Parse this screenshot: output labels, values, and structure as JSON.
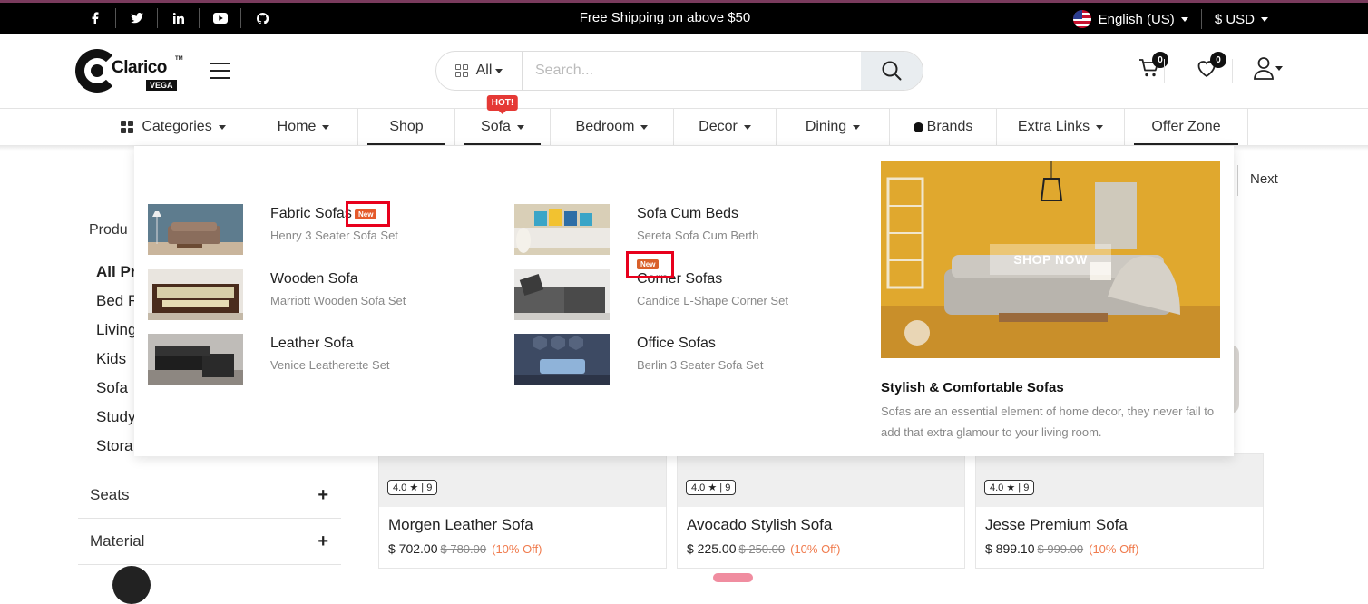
{
  "topbar": {
    "social": [
      {
        "name": "facebook-icon",
        "glyph": "f"
      },
      {
        "name": "twitter-icon",
        "glyph": "t"
      },
      {
        "name": "linkedin-icon",
        "glyph": "in"
      },
      {
        "name": "youtube-icon",
        "glyph": "yt"
      },
      {
        "name": "github-icon",
        "glyph": "gh"
      }
    ],
    "promo": "Free Shipping on above $50",
    "language": "English (US)",
    "currency": "$ USD"
  },
  "header": {
    "logo_text": "Clarico",
    "logo_tm": "TM",
    "logo_sub": "VEGA",
    "search": {
      "category": "All",
      "placeholder": "Search..."
    },
    "cart_count": "0",
    "wishlist_count": "0"
  },
  "nav": {
    "categories": "Categories",
    "home": "Home",
    "shop": "Shop",
    "sofa": "Sofa",
    "sofa_badge": "HOT!",
    "bedroom": "Bedroom",
    "decor": "Decor",
    "dining": "Dining",
    "brands": "Brands",
    "extra_links": "Extra Links",
    "offer_zone": "Offer Zone"
  },
  "mega_menu": {
    "items": [
      {
        "title": "Fabric Sofas",
        "subtitle": "Henry 3 Seater Sofa Set",
        "tag": "New"
      },
      {
        "title": "Wooden Sofa",
        "subtitle": "Marriott Wooden Sofa Set"
      },
      {
        "title": "Leather Sofa",
        "subtitle": "Venice Leatherette Set"
      },
      {
        "title": "Sofa Cum Beds",
        "subtitle": "Sereta Sofa Cum Berth"
      },
      {
        "title": "Corner Sofas",
        "subtitle": "Candice L-Shape Corner Set",
        "tag": "New"
      },
      {
        "title": "Office Sofas",
        "subtitle": "Berlin 3 Seater Sofa Set"
      }
    ],
    "banner": {
      "cta": "SHOP NOW",
      "title": "Stylish & Comfortable Sofas",
      "description": "Sofas are an essential element of home decor, they never fail to add that extra glamour to your living room."
    }
  },
  "page": {
    "pager_next": "Next",
    "sidebar_heading": "Produ",
    "categories": [
      "All Pr",
      "Bed R",
      "Living",
      "Kids",
      "Sofa",
      "Study",
      "Stora"
    ],
    "filters": [
      "Seats",
      "Material"
    ],
    "products": [
      {
        "rating": "4.0",
        "reviews": "9",
        "name": "Morgen Leather Sofa",
        "price": "$ 702.00",
        "old_price": "$ 780.00",
        "discount": "(10% Off)"
      },
      {
        "rating": "4.0",
        "reviews": "9",
        "name": "Avocado Stylish Sofa",
        "price": "$ 225.00",
        "old_price": "$ 250.00",
        "discount": "(10% Off)"
      },
      {
        "rating": "4.0",
        "reviews": "9",
        "name": "Jesse Premium Sofa",
        "price": "$ 899.10",
        "old_price": "$ 999.00",
        "discount": "(10% Off)"
      }
    ]
  }
}
